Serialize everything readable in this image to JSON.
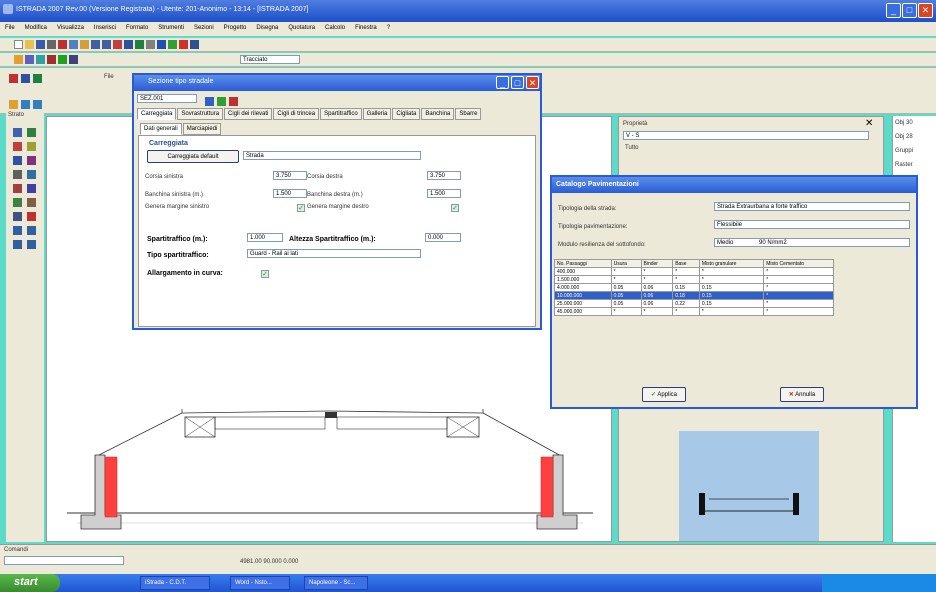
{
  "app": {
    "title": "ISTRADA 2007 Rev.00 (Versione Registrata) - Utente: 201-Anonimo - 13:14 - [ISTRADA 2007]"
  },
  "menu": {
    "items": [
      "File",
      "Modifica",
      "Visualizza",
      "Inserisci",
      "Formato",
      "Strumenti",
      "Sezioni",
      "Progetto",
      "Disegna",
      "Quotatura",
      "Calcolo",
      "Finestra",
      "?"
    ]
  },
  "toolbar": {
    "layer_select": "Tracciato"
  },
  "left_toolbar": {
    "label_strato": "Strato",
    "label_file": "File"
  },
  "dialog": {
    "title": "Sezione tipo stradale",
    "combo": "SEZ.001",
    "tabs": [
      "Carreggiata",
      "Sovrastruttura",
      "Cigli dei rilevati",
      "Cigli di trincea",
      "Spartitraffico",
      "Galleria",
      "Cigliata",
      "Banchina",
      "Sbarre"
    ],
    "subtabs": [
      "Dati generali",
      "Marciapiedi"
    ],
    "section_title": "Carreggiata",
    "btn_default": "Carreggiata default",
    "strada_value": "Strada",
    "corsia_sx_label": "Corsia sinistra",
    "corsia_sx_value": "3.750",
    "corsia_dx_label": "Corsia destra",
    "corsia_dx_value": "3.750",
    "banch_sx_label": "Banchina sinistra (m.)",
    "banch_sx_value": "1.500",
    "banch_dx_label": "Banchina destra (m.)",
    "banch_dx_value": "1.500",
    "margine_sx_label": "Genera margine sinistro",
    "margine_dx_label": "Genera margine destro",
    "spartitraffico_label": "Spartitraffico (m.):",
    "spartitraffico_value": "1.000",
    "altezza_label": "Altezza Spartitraffico (m.):",
    "altezza_value": "0.000",
    "tipo_label": "Tipo spartitraffico:",
    "tipo_value": "Guard - Rail ai lati",
    "allargamento_label": "Allargamento in curva:",
    "check_mark": "✓"
  },
  "catalog": {
    "title": "Catalogo Pavimentazioni",
    "tip_strada_label": "Tipologia della strada:",
    "tip_strada_value": "Strada Extraurbana a forte traffico",
    "tip_pav_label": "Tipologia pavimentazione:",
    "tip_pav_value": "Flessibile",
    "modulo_label": "Modulo resilienza del sottofondo:",
    "modulo_value": "Medio",
    "modulo_extra": "90 N/mm2",
    "headers": [
      "No. Passaggi",
      "Usura",
      "Binder",
      "Base",
      "Misto granulare",
      "Misto Cementato"
    ],
    "rows": [
      [
        "400.000",
        "*",
        "*",
        "*",
        "*",
        "*"
      ],
      [
        "1.500.000",
        "*",
        "*",
        "*",
        "*",
        "*"
      ],
      [
        "4.000.000",
        "0.05",
        "0.06",
        "0.15",
        "0.15",
        "*"
      ],
      [
        "10.000.000",
        "0.05",
        "0.06",
        "0.18",
        "0.15",
        "*"
      ],
      [
        "25.000.000",
        "0.05",
        "0.06",
        "0.22",
        "0.15",
        "*"
      ],
      [
        "45.000.000",
        "*",
        "*",
        "*",
        "*",
        "*"
      ]
    ],
    "selected_row": 3,
    "apply_label": "Applica",
    "cancel_label": "Annulla"
  },
  "props": {
    "title": "Proprietà",
    "value": "V - S",
    "line2": "Tutto"
  },
  "farright": {
    "items": [
      "Obj 30",
      "Obj 28",
      "Gruppi",
      "Raster"
    ]
  },
  "command": {
    "label": "Comandi",
    "coords": "4981.00 90.000 0.000"
  },
  "taskbar": {
    "start": "start",
    "tasks": [
      "iStrada - C.D.T.",
      "Word - Nsto...",
      "Napoleone - Sc..."
    ]
  }
}
